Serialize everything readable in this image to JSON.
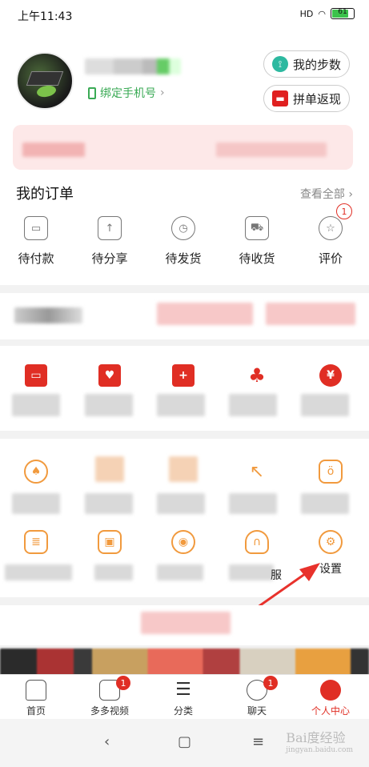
{
  "status": {
    "time": "上午11:43",
    "signal": "HD",
    "battery": "61"
  },
  "header": {
    "bind_phone": "绑定手机号",
    "steps_label": "我的步数",
    "cashback_label": "拼单返现"
  },
  "orders": {
    "title": "我的订单",
    "view_all": "查看全部",
    "items": [
      {
        "label": "待付款",
        "icon": "wallet-icon"
      },
      {
        "label": "待分享",
        "icon": "share-icon"
      },
      {
        "label": "待发货",
        "icon": "clock-icon"
      },
      {
        "label": "待收货",
        "icon": "truck-icon"
      },
      {
        "label": "评价",
        "icon": "review-icon",
        "badge": "1"
      }
    ]
  },
  "tools": {
    "settings_label": "设置",
    "partial_label": "服"
  },
  "tabs": [
    {
      "label": "首页",
      "icon": "home-icon"
    },
    {
      "label": "多多视频",
      "icon": "video-icon",
      "badge": "1"
    },
    {
      "label": "分类",
      "icon": "category-icon"
    },
    {
      "label": "聊天",
      "icon": "chat-icon",
      "badge": "1"
    },
    {
      "label": "个人中心",
      "icon": "profile-icon",
      "active": true
    }
  ],
  "colors": {
    "brand_red": "#e02e24",
    "accent_orange": "#f19a3e",
    "green": "#3aaa55"
  },
  "watermark": {
    "text": "Bai度经验",
    "url": "jingyan.baidu.com"
  }
}
